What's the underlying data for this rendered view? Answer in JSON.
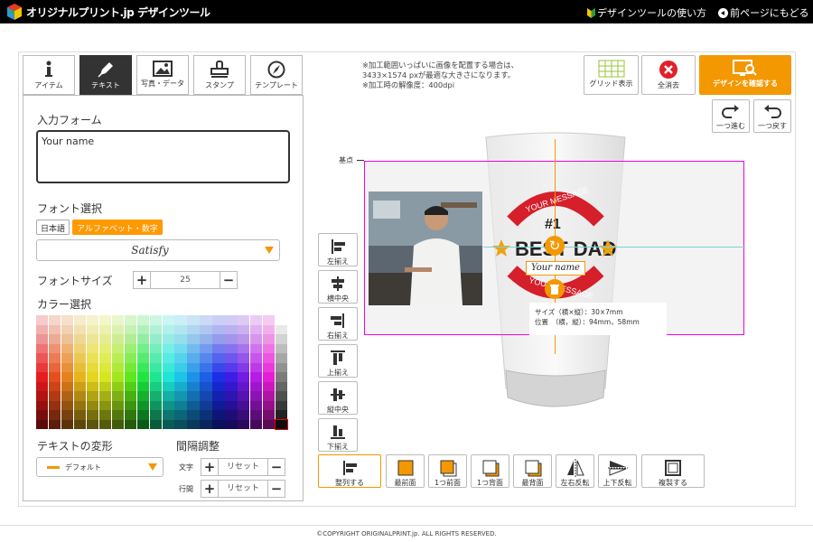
{
  "header": {
    "brand": "オリジナルプリント.jp デザインツール",
    "help_link": "デザインツールの使い方",
    "back_link": "前ページにもどる"
  },
  "tabs": [
    {
      "label": "アイテム",
      "icon": "info-icon"
    },
    {
      "label": "テキスト",
      "icon": "pen-icon"
    },
    {
      "label": "写真・データ",
      "icon": "image-icon"
    },
    {
      "label": "スタンプ",
      "icon": "stamp-icon"
    },
    {
      "label": "テンプレート",
      "icon": "compass-icon"
    }
  ],
  "text_panel": {
    "input_form_label": "入力フォーム",
    "input_value": "Your name",
    "font_select_label": "フォント選択",
    "font_tab_japanese": "日本語",
    "font_tab_alpha": "アルファベット・数字",
    "font_name": "Satisfy",
    "font_size_label": "フォントサイズ",
    "font_size_value": "25",
    "color_label": "カラー選択",
    "transform_label": "テキストの変形",
    "transform_value": "デフォルト",
    "spacing_label": "間隔調整",
    "char_label": "文字",
    "line_label": "行間",
    "reset_label": "リセット"
  },
  "notice": {
    "line1": "※加工範囲いっぱいに画像を配置する場合は、",
    "line2": "3433×1574 pxが最適な大きさになります。",
    "line3": "※加工時の解像度：400dpi"
  },
  "toolbar": {
    "grid_label": "グリッド表示",
    "clear_label": "全消去",
    "confirm_label": "デザインを確認する",
    "redo_label": "一つ進む",
    "undo_label": "一つ戻す"
  },
  "canvas": {
    "origin_label": "基点",
    "size_line": "サイズ（横×縦）：30×7mm",
    "pos_line": "位置　（横，縦）：94mm，58mm",
    "logo_top": "YOUR MESSAGE",
    "logo_number": "#1",
    "logo_main": "BEST DAD",
    "logo_name": "Your name",
    "logo_bottom": "YOUR MESSAGE"
  },
  "align_buttons": [
    "左揃え",
    "横中央",
    "右揃え",
    "上揃え",
    "縦中央",
    "下揃え"
  ],
  "arrange_buttons": [
    "整列する",
    "最前面",
    "1つ前面",
    "1つ背面",
    "最背面",
    "左右反転",
    "上下反転",
    "複製する"
  ],
  "footer": {
    "copyright": "©COPYRIGHT ORIGINALPRINT.jp. ALL RIGHTS RESERVED."
  },
  "colors": {
    "accent": "#f39800",
    "header_bg": "#000000",
    "selection": "#ee00ee"
  }
}
